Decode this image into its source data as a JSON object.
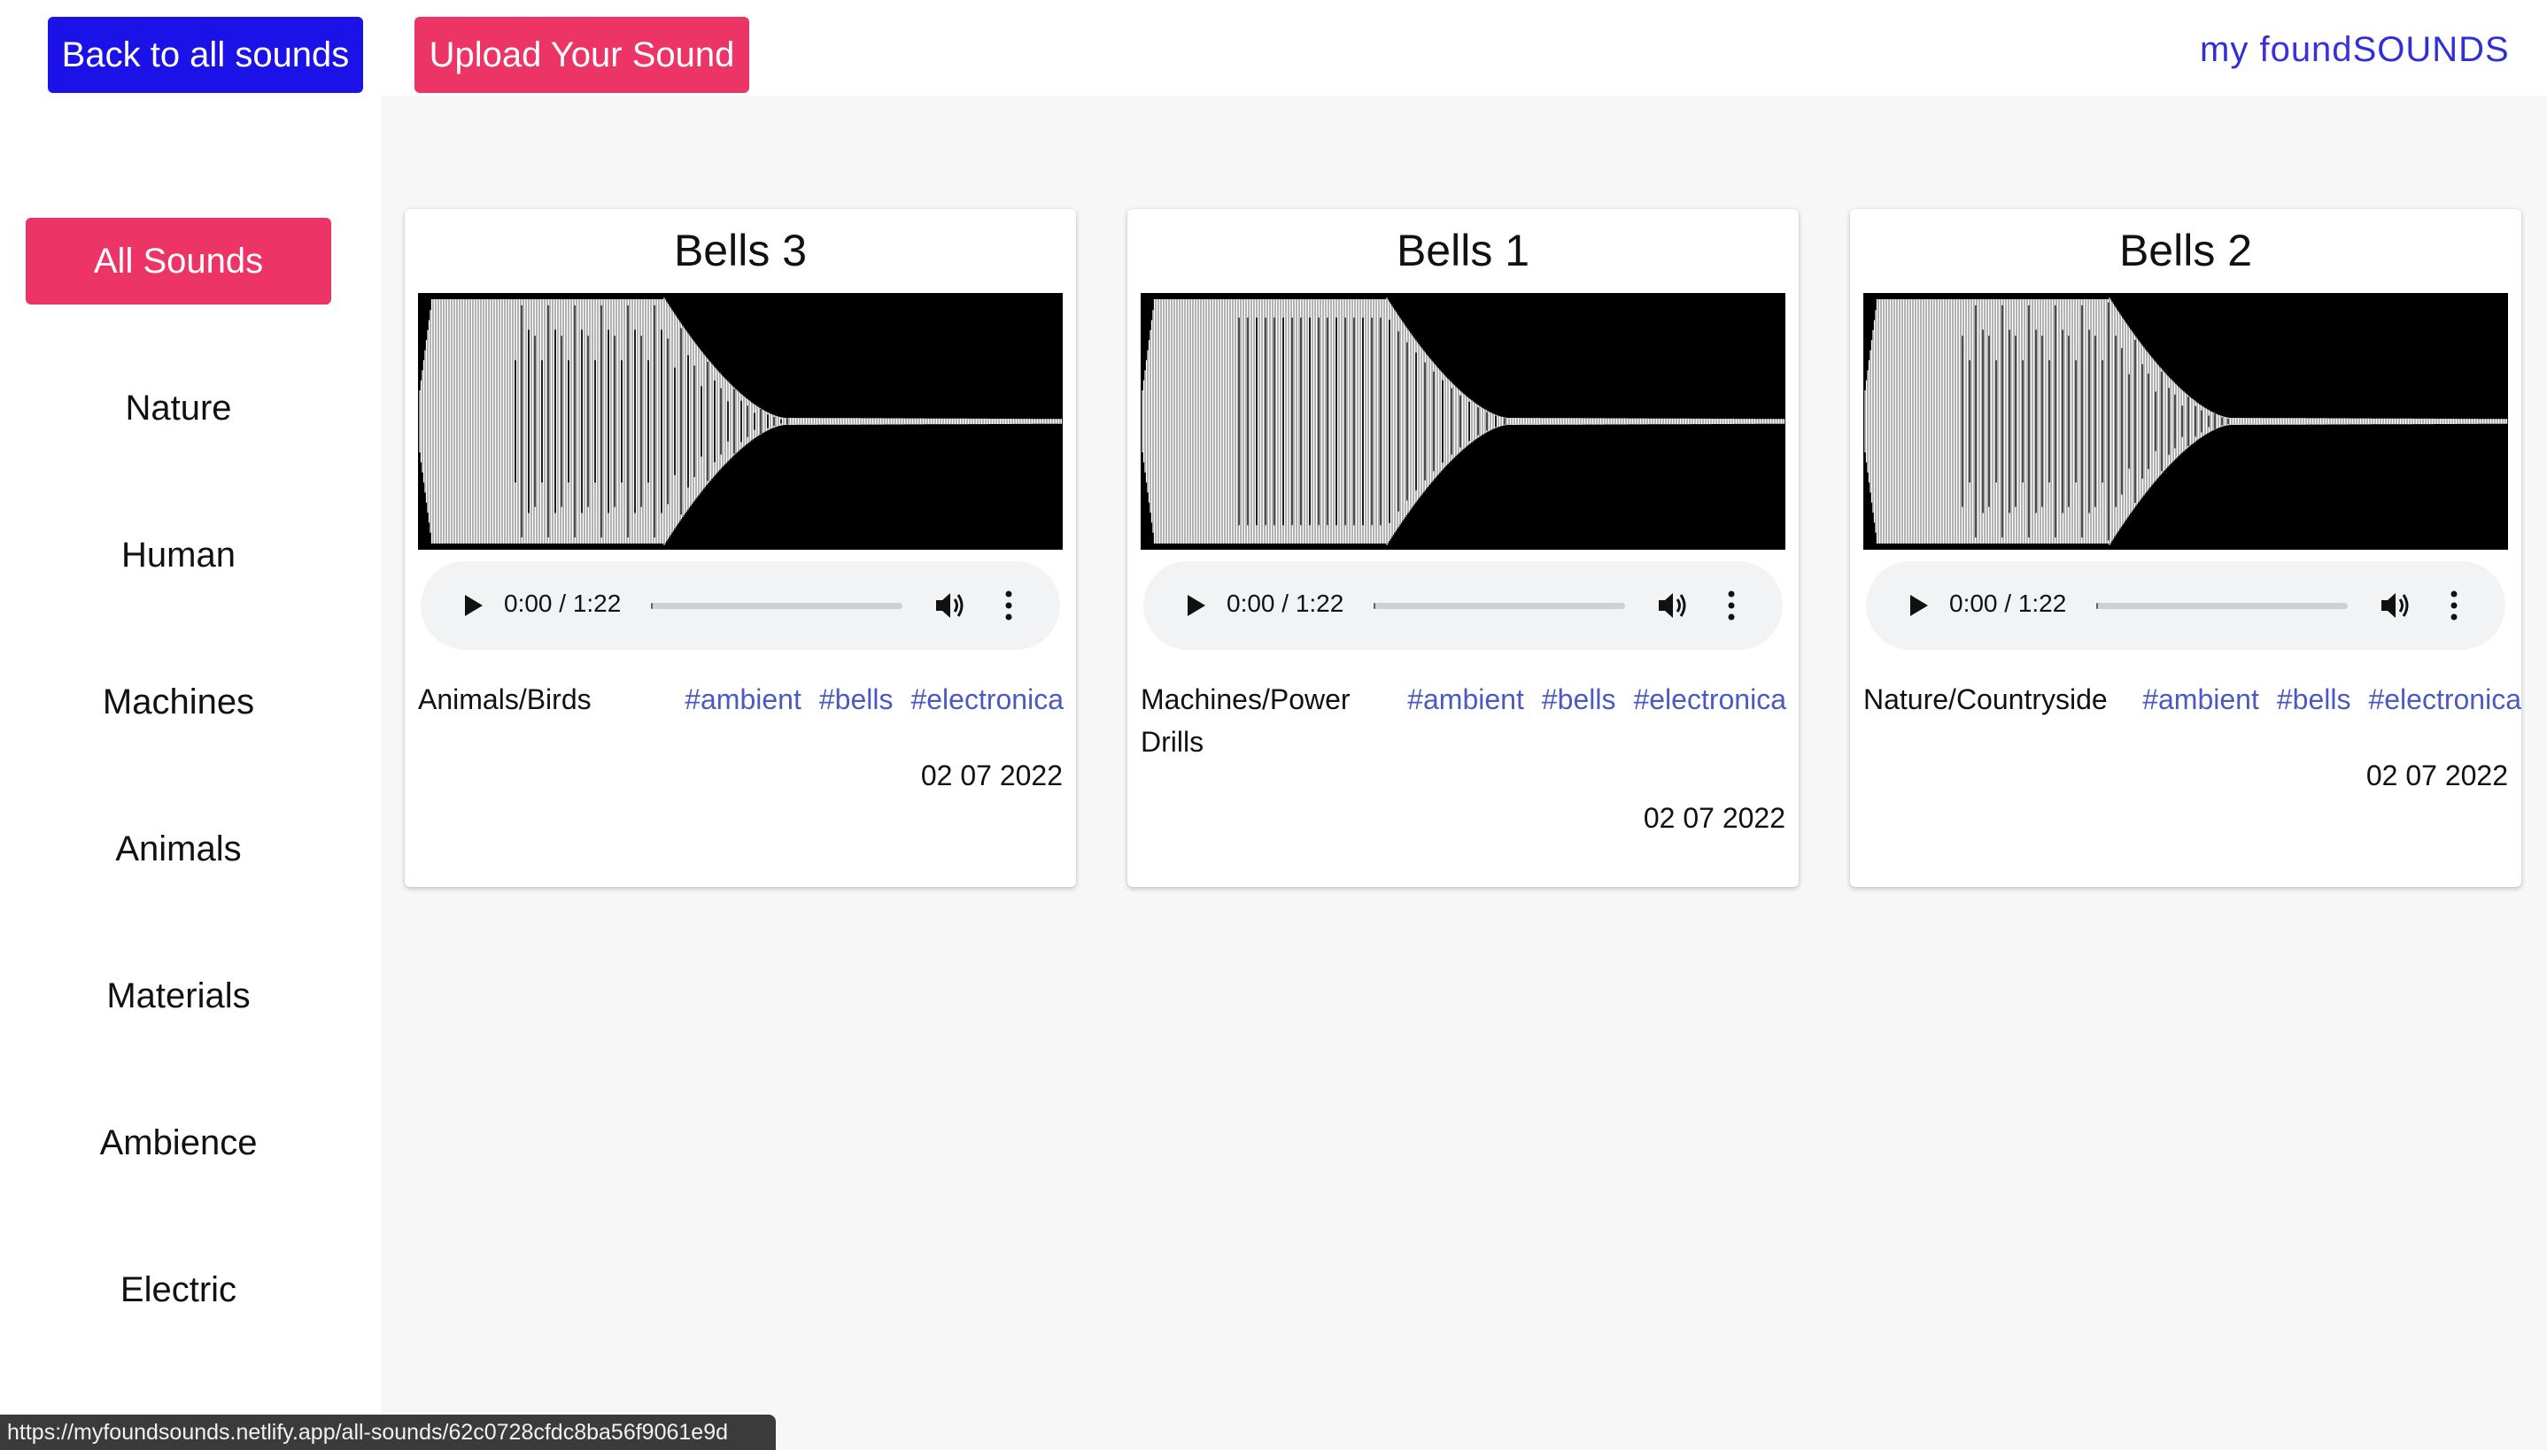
{
  "header": {
    "back_label": "Back to all sounds",
    "upload_label": "Upload Your Sound",
    "logo": {
      "my": "my",
      "found": "found",
      "sounds": "SOUNDS",
      "icon": "waveform-logo-icon"
    }
  },
  "colors": {
    "back_button": "#1a12e6",
    "accent_pink": "#ec3466",
    "tag_link": "#4b5ac2",
    "main_bg": "#f7f7f7"
  },
  "sidebar": {
    "items": [
      {
        "label": "All Sounds",
        "active": true
      },
      {
        "label": "Nature"
      },
      {
        "label": "Human"
      },
      {
        "label": "Machines"
      },
      {
        "label": "Animals"
      },
      {
        "label": "Materials"
      },
      {
        "label": "Ambience"
      },
      {
        "label": "Electric"
      }
    ]
  },
  "cards": [
    {
      "title": "Bells 3",
      "time": "0:00 / 1:22",
      "progress": 0,
      "category": "Animals/Birds",
      "tags": [
        "#ambient",
        "#bells",
        "#electronica"
      ],
      "date": "02 07 2022"
    },
    {
      "title": "Bells 1",
      "time": "0:00 / 1:22",
      "progress": 0,
      "category": "Machines/Power Drills",
      "tags": [
        "#ambient",
        "#bells",
        "#electronica"
      ],
      "date": "02 07 2022"
    },
    {
      "title": "Bells 2",
      "time": "0:00 / 1:22",
      "progress": 0,
      "category": "Nature/Countryside",
      "tags": [
        "#ambient",
        "#bells",
        "#electronica"
      ],
      "date": "02 07 2022"
    }
  ],
  "status_url": "https://myfoundsounds.netlify.app/all-sounds/62c0728cfdc8ba56f9061e9d"
}
